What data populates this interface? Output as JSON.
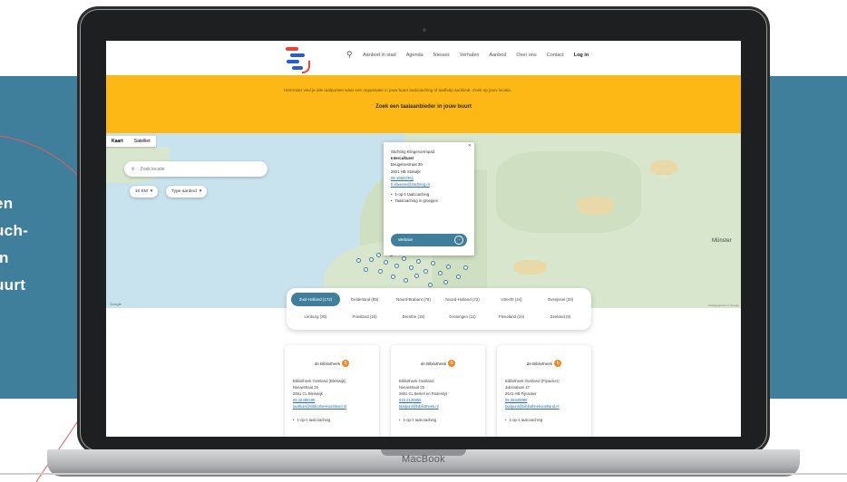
{
  "side_text": [
    "en",
    "uch-",
    " in",
    "uurt"
  ],
  "device_label": "MacBook",
  "nav": {
    "links": [
      "Aanbod in stad",
      "Agenda",
      "Nieuws",
      "Verhalen",
      "Aanbod",
      "Over ons",
      "Contact"
    ],
    "login": "Log in"
  },
  "banner": {
    "note": "Hieronder vind je alle taalpunten waar een organisatie in jouw buurt taalcoaching of taalhulp aanbiedt. Zoek op jouw locatie.",
    "title": "Zoek een taalaanbieder in jouw buurt"
  },
  "map": {
    "toggle": [
      "Kaart",
      "Satelliet"
    ],
    "search_placeholder": "Zoek locatie",
    "distance_filter": "10 KM",
    "type_filter": "Type aanbod",
    "place_label": "Münster",
    "attribution": "Kaartgegevens © Google",
    "google": "Google",
    "popup": {
      "org": "Stichting Klingeroermpad",
      "name": "Interculturel",
      "street": "Beugelsestraat 30",
      "city": "2821 HB Stolwijk",
      "phone": "06 16522361",
      "email": "h.klaasse@stichting.nl",
      "items": [
        "1-op-1 taalcoaching",
        "Taalcoaching in groepjes"
      ],
      "button": "Website"
    }
  },
  "regions": {
    "row1": [
      "Zuid-Holland (172)",
      "Gelderland (89)",
      "Noord-Brabant (78)",
      "Noord-Holland (72)",
      "Utrecht (44)",
      "Overijssel (33)"
    ],
    "row2": [
      "Limburg (30)",
      "Friesland (16)",
      "Drenthe (15)",
      "Groningen (11)",
      "Flevoland (10)",
      "Zeeland (9)"
    ]
  },
  "cards": [
    {
      "logo": "de Bibliotheek",
      "name": "Bibliotheek Oostland (Bleiswijk)",
      "street": "Nieuwstraat 25",
      "city": "2651 CL Bleiswijk",
      "phone": "06 22488196",
      "email": "taalhuis@bibliotheekoostland.nl",
      "item": "1-op-1 taalcoaching"
    },
    {
      "logo": "de Bibliotheek",
      "name": "Bibliotheek Oostland",
      "street": "Nieuwstraat 25",
      "city": "2651 CL Berkel en Rodenrijs",
      "phone": "015 2125855",
      "email": "taalpunt@bibliotheek.nl",
      "item": "1-op-1 taalcoaching"
    },
    {
      "logo": "de Bibliotheek",
      "name": "Bibliotheek Oostland (Pijnacker)",
      "street": "Julianalaan 47",
      "city": "2641 HB Pijnacker",
      "phone": "06 28349898",
      "email": "taalpunt@bibliotheekoostland.nl",
      "item": "1-op-1 taalcoaching"
    }
  ],
  "colors": {
    "accent": "#3f7f9b",
    "banner": "#fdb815",
    "link": "#2a6fb0"
  }
}
